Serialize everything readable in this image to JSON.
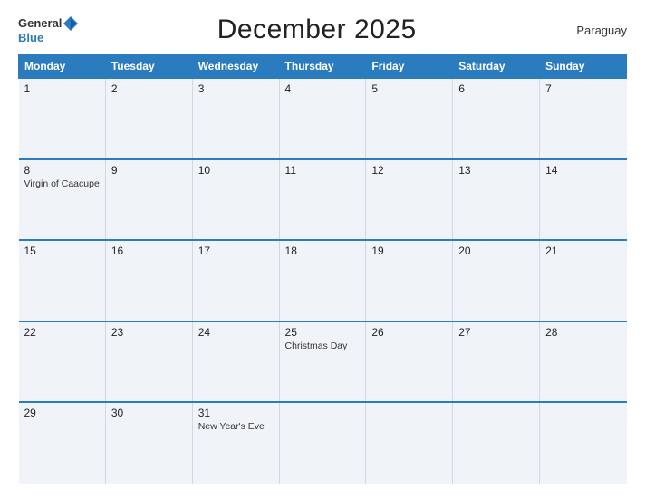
{
  "header": {
    "title": "December 2025",
    "country": "Paraguay",
    "logo_general": "General",
    "logo_blue": "Blue"
  },
  "columns": [
    "Monday",
    "Tuesday",
    "Wednesday",
    "Thursday",
    "Friday",
    "Saturday",
    "Sunday"
  ],
  "weeks": [
    [
      {
        "day": "1",
        "event": ""
      },
      {
        "day": "2",
        "event": ""
      },
      {
        "day": "3",
        "event": ""
      },
      {
        "day": "4",
        "event": ""
      },
      {
        "day": "5",
        "event": ""
      },
      {
        "day": "6",
        "event": ""
      },
      {
        "day": "7",
        "event": ""
      }
    ],
    [
      {
        "day": "8",
        "event": "Virgin of Caacupe"
      },
      {
        "day": "9",
        "event": ""
      },
      {
        "day": "10",
        "event": ""
      },
      {
        "day": "11",
        "event": ""
      },
      {
        "day": "12",
        "event": ""
      },
      {
        "day": "13",
        "event": ""
      },
      {
        "day": "14",
        "event": ""
      }
    ],
    [
      {
        "day": "15",
        "event": ""
      },
      {
        "day": "16",
        "event": ""
      },
      {
        "day": "17",
        "event": ""
      },
      {
        "day": "18",
        "event": ""
      },
      {
        "day": "19",
        "event": ""
      },
      {
        "day": "20",
        "event": ""
      },
      {
        "day": "21",
        "event": ""
      }
    ],
    [
      {
        "day": "22",
        "event": ""
      },
      {
        "day": "23",
        "event": ""
      },
      {
        "day": "24",
        "event": ""
      },
      {
        "day": "25",
        "event": "Christmas Day"
      },
      {
        "day": "26",
        "event": ""
      },
      {
        "day": "27",
        "event": ""
      },
      {
        "day": "28",
        "event": ""
      }
    ],
    [
      {
        "day": "29",
        "event": ""
      },
      {
        "day": "30",
        "event": ""
      },
      {
        "day": "31",
        "event": "New Year's Eve"
      },
      {
        "day": "",
        "event": ""
      },
      {
        "day": "",
        "event": ""
      },
      {
        "day": "",
        "event": ""
      },
      {
        "day": "",
        "event": ""
      }
    ]
  ]
}
